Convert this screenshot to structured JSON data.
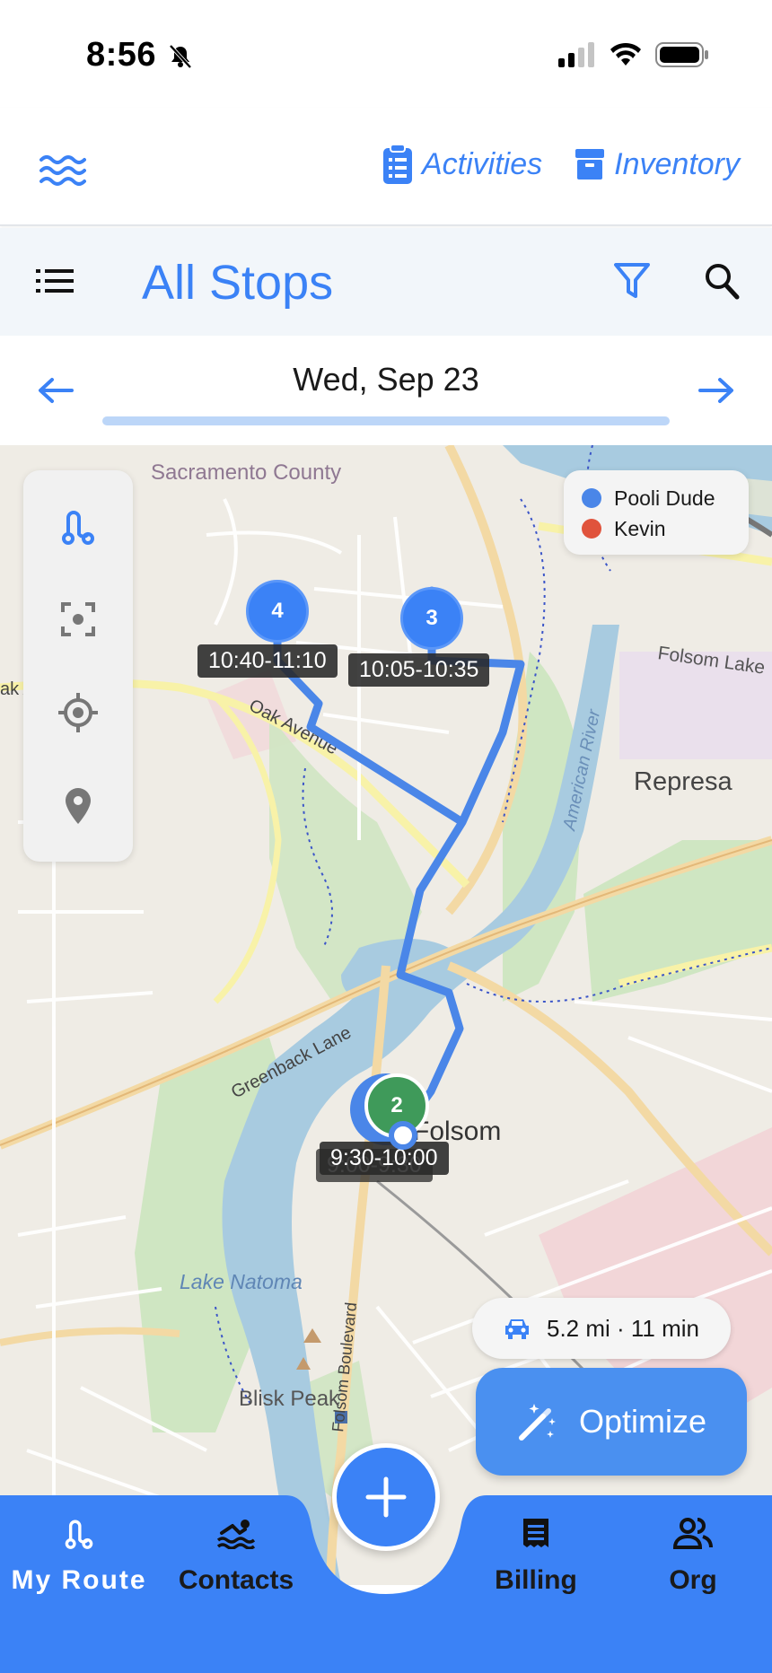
{
  "status_bar": {
    "time": "8:56"
  },
  "header": {
    "menu_icon": "waves-icon",
    "activities_label": "Activities",
    "inventory_label": "Inventory"
  },
  "title_bar": {
    "title": "All Stops"
  },
  "date_bar": {
    "date": "Wed, Sep 23"
  },
  "map": {
    "legend": [
      {
        "name": "Pooli Dude",
        "color": "#4a86e8"
      },
      {
        "name": "Kevin",
        "color": "#e0533c"
      }
    ],
    "places": {
      "sacramento_county": "Sacramento County",
      "folsom_lake": "Folsom Lake",
      "represa": "Represa",
      "american_river": "American River",
      "oak_avenue": "Oak Avenue",
      "oak_avenue_partial": "ak Avenue",
      "greenback_lane": "Greenback Lane",
      "folsom": "Folsom",
      "lake_natoma": "Lake Natoma",
      "folsom_boulevard": "Folsom Boulevard",
      "blisk_peak": "Blisk Peak"
    },
    "stops": [
      {
        "number": "4",
        "time": "10:40-11:10"
      },
      {
        "number": "3",
        "time": "10:05-10:35"
      },
      {
        "number": "2",
        "time": "9:30-10:00"
      },
      {
        "number": "",
        "time": "9:00-9:30"
      }
    ],
    "route_summary": "5.2 mi · 11 min",
    "optimize_label": "Optimize"
  },
  "bottom_nav": {
    "my_route": "My Route",
    "contacts": "Contacts",
    "billing": "Billing",
    "org": "Org"
  },
  "colors": {
    "accent": "#3b82f6",
    "route_line": "#4a86e8",
    "stop_complete": "#3f9a5a"
  }
}
